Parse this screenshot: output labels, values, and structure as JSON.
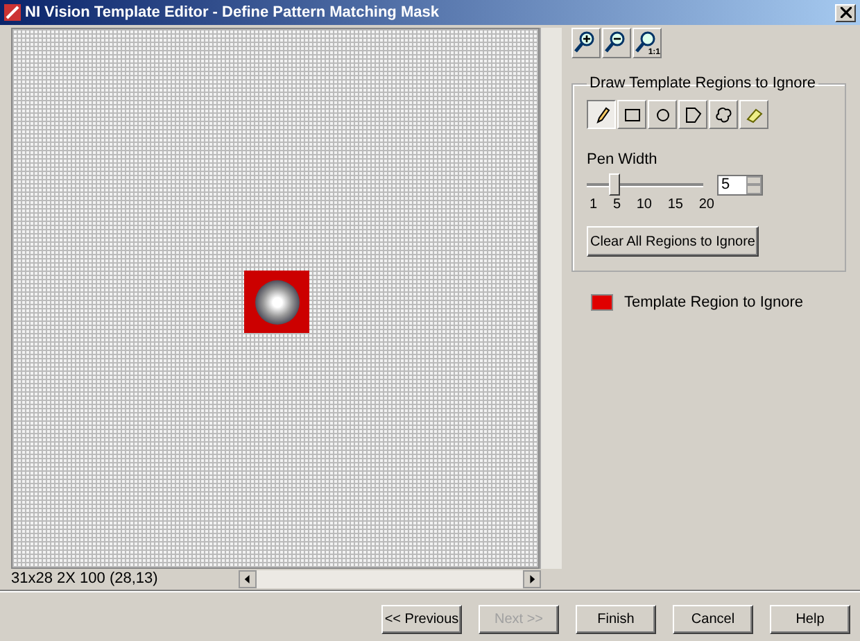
{
  "window": {
    "title": "NI Vision Template Editor - Define Pattern Matching Mask"
  },
  "zoom_tools": [
    {
      "kind": "zoom-in"
    },
    {
      "kind": "zoom-out"
    },
    {
      "kind": "zoom-fit",
      "label": "1:1"
    }
  ],
  "image_view": {
    "status": "31x28 2X  100  (28,13)"
  },
  "draw_group": {
    "title": "Draw Template Regions to Ignore",
    "tools": [
      {
        "kind": "pencil",
        "selected": true
      },
      {
        "kind": "rectangle",
        "selected": false
      },
      {
        "kind": "oval",
        "selected": false
      },
      {
        "kind": "polygon",
        "selected": false
      },
      {
        "kind": "freehand",
        "selected": false
      },
      {
        "kind": "eraser",
        "selected": false
      }
    ],
    "pen_width": {
      "label": "Pen Width",
      "level": 0.21,
      "value": "5",
      "ticks": [
        "1",
        "5",
        "10",
        "15",
        "20"
      ]
    },
    "clear_button": "Clear All Regions to Ignore"
  },
  "legend": {
    "label": "Template Region to Ignore",
    "color": "#e00000"
  },
  "buttons": [
    {
      "label": "<< Previous",
      "disabled": false
    },
    {
      "label": "Next >>",
      "disabled": true
    },
    {
      "label": "Finish",
      "disabled": false
    },
    {
      "label": "Cancel",
      "disabled": false
    },
    {
      "label": "Help",
      "disabled": false
    }
  ]
}
